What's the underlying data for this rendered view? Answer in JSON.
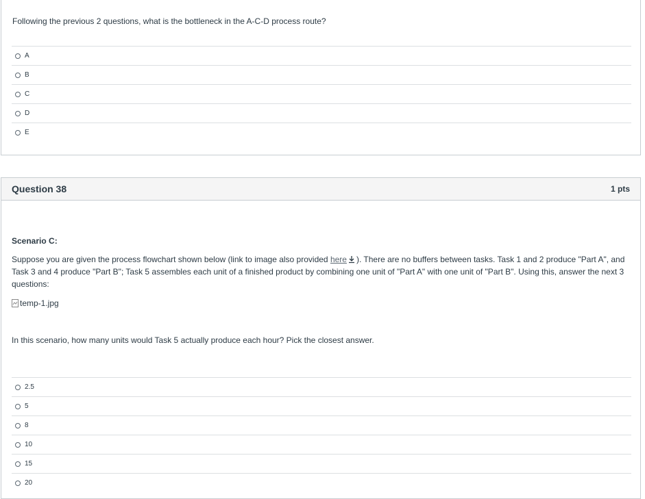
{
  "prev_question": {
    "text": "Following the previous 2 questions, what is the bottleneck in the A-C-D process route?",
    "answers": [
      "A",
      "B",
      "C",
      "D",
      "E"
    ]
  },
  "question38": {
    "title": "Question 38",
    "points": "1 pts",
    "scenario_heading": "Scenario C:",
    "paragraph_before_link": "Suppose you are given the process flowchart shown below (link to image also provided ",
    "link_text": "here",
    "paragraph_after_link": "). There are no buffers between tasks. Task 1 and 2 produce \"Part A\", and Task 3 and 4 produce \"Part B\"; Task 5 assembles each unit of a finished product by combining one unit of \"Part A\" with one unit of \"Part B\". Using this, answer the next 3 questions:",
    "image_alt": "temp-1.jpg",
    "prompt": "In this scenario, how many units would Task 5 actually produce each hour? Pick the closest answer.",
    "answers": [
      "2.5",
      "5",
      "8",
      "10",
      "15",
      "20"
    ]
  }
}
